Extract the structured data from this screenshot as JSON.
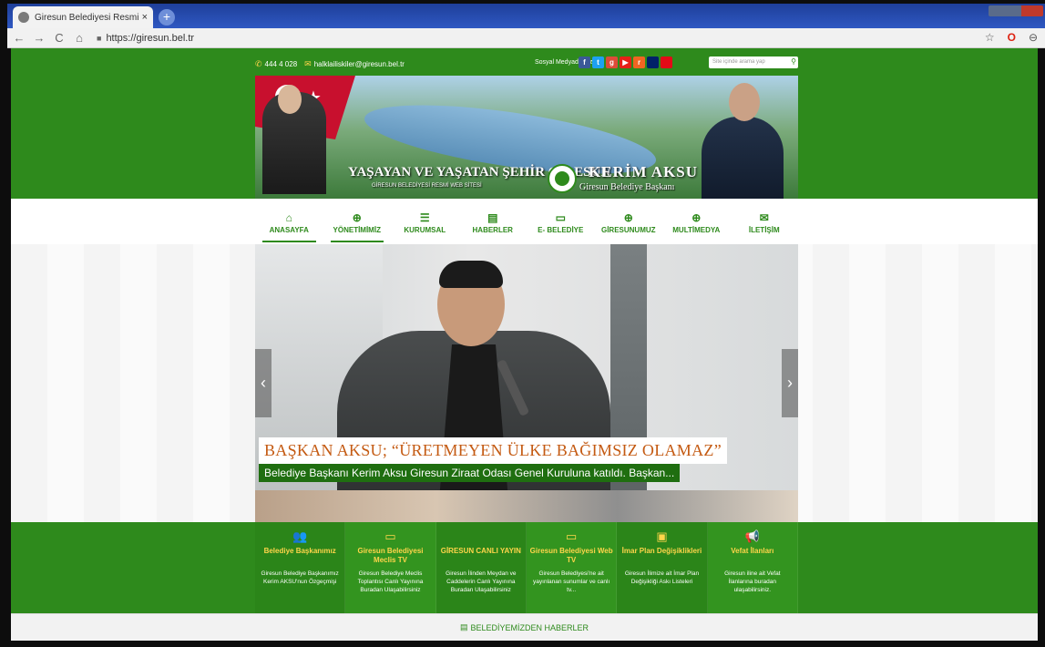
{
  "browser": {
    "tab_title": "Giresun Belediyesi Resmi Web S...",
    "tab_close": "×",
    "new_tab": "+",
    "url": "https://giresun.bel.tr",
    "nav_back": "←",
    "nav_forward": "→",
    "nav_reload": "C",
    "nav_home": "⌂",
    "star": "☆",
    "opera": "O",
    "account": "⊖"
  },
  "topbar": {
    "phone": "444 4 028",
    "email": "halklailiskiler@giresun.bel.tr",
    "social_label": "Sosyal Medyada Biz",
    "search_placeholder": "Site içinde arama yap",
    "social": [
      {
        "name": "facebook",
        "label": "f",
        "color": "#3b5998"
      },
      {
        "name": "twitter",
        "label": "t",
        "color": "#1da1f2"
      },
      {
        "name": "google-plus",
        "label": "g",
        "color": "#dd4b39"
      },
      {
        "name": "youtube",
        "label": "▶",
        "color": "#e62117"
      },
      {
        "name": "rss",
        "label": "r",
        "color": "#f26522"
      },
      {
        "name": "english",
        "label": "",
        "color": "#012169"
      },
      {
        "name": "turkish",
        "label": "",
        "color": "#e30a17"
      }
    ]
  },
  "banner": {
    "slogan": "YAŞAYAN VE YAŞATAN ŞEHİR GİRESUN",
    "slogan_sub": "GİRESUN BELEDİYESİ RESMİ WEB SİTESİ",
    "mayor_name": "KERİM AKSU",
    "mayor_title": "Giresun Belediye Başkanı"
  },
  "nav": [
    {
      "label": "ANASAYFA",
      "icon": "home-icon",
      "glyph": "⌂"
    },
    {
      "label": "YÖNETİMİMİZ",
      "icon": "plus-circle-icon",
      "glyph": "⊕"
    },
    {
      "label": "KURUMSAL",
      "icon": "menu-icon",
      "glyph": "☰"
    },
    {
      "label": "HABERLER",
      "icon": "newspaper-icon",
      "glyph": "▤"
    },
    {
      "label": "E- BELEDİYE",
      "icon": "monitor-icon",
      "glyph": "▭"
    },
    {
      "label": "GİRESUNUMUZ",
      "icon": "plus-circle-icon",
      "glyph": "⊕"
    },
    {
      "label": "MULTİMEDYA",
      "icon": "plus-circle-icon",
      "glyph": "⊕"
    },
    {
      "label": "İLETİŞİM",
      "icon": "envelope-icon",
      "glyph": "✉"
    }
  ],
  "slider": {
    "headline": "BAŞKAN AKSU; “ÜRETMEYEN ÜLKE BAĞIMSIZ OLAMAZ”",
    "summary": "Belediye Başkanı Kerim Aksu Giresun Ziraat Odası Genel Kuruluna katıldı. Başkan...",
    "prev": "‹",
    "next": "›"
  },
  "boxes": [
    {
      "title": "Belediye Başkanımız",
      "desc": "Giresun Belediye Başkanımız Kerim AKSU'nun Özgeçmişi",
      "icon": "users-icon",
      "glyph": "👥"
    },
    {
      "title": "Giresun Belediyesi Meclis TV",
      "desc": "Giresun Belediye Meclis Toplantısı Canlı Yayınına Buradan Ulaşabilirsiniz",
      "icon": "monitor-icon",
      "glyph": "▭"
    },
    {
      "title": "GİRESUN CANLI YAYIN",
      "desc": "Giresun İlinden Meydan ve Caddelerin Canlı Yayınına Buradan Ulaşabilirsiniz",
      "icon": "",
      "glyph": ""
    },
    {
      "title": "Giresun Belediyesi Web TV",
      "desc": "Giresun Belediyesi'ne ait yayınlanan sunumlar ve canlı tv...",
      "icon": "monitor-icon",
      "glyph": "▭"
    },
    {
      "title": "İmar Plan Değişiklikleri",
      "desc": "Giresun İlimize ait İmar Plan Değişikliği Askı Listeleri",
      "icon": "briefcase-icon",
      "glyph": "▣"
    },
    {
      "title": "Vefat İlanları",
      "desc": "Giresun iline ait Vefat İlanlarına buradan ulaşabilirsiniz.",
      "icon": "megaphone-icon",
      "glyph": "📢"
    }
  ],
  "footer": {
    "label": "BELEDİYEMİZDEN HABERLER"
  },
  "colors": {
    "brand_green": "#2e8a1c",
    "accent_yellow": "#ffd54a",
    "headline_orange": "#c45a12"
  }
}
